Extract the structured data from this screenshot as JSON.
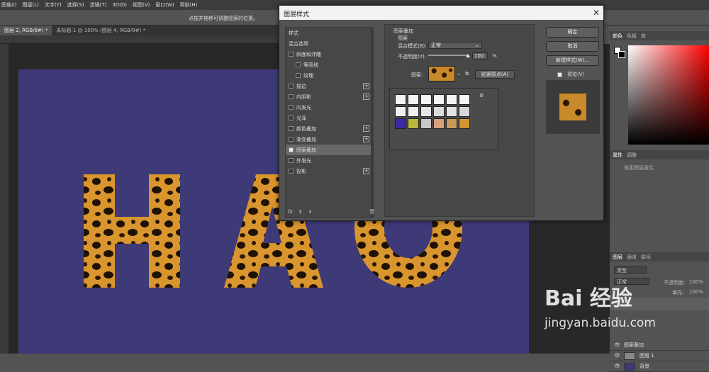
{
  "menubar": [
    "图像(I)",
    "图层(L)",
    "文字(Y)",
    "选择(S)",
    "滤镜(T)",
    "3D(D)",
    "视图(V)",
    "窗口(W)",
    "帮助(H)"
  ],
  "options_hint": "点按并拖移可调整图案的位置。",
  "tabs": [
    "图层 2, RGB/8#) *",
    "未标题-1 @ 100% (图层 4, RGB/8#) *"
  ],
  "dialog": {
    "title": "图层样式",
    "list_header": "样式",
    "items": [
      {
        "label": "混合选项",
        "check": false,
        "plus": false,
        "box": false,
        "selected": false
      },
      {
        "label": "斜面和浮雕",
        "check": false,
        "plus": false,
        "box": true,
        "selected": false
      },
      {
        "label": "等高线",
        "check": false,
        "plus": false,
        "box": true,
        "selected": false,
        "indent": true
      },
      {
        "label": "纹理",
        "check": false,
        "plus": false,
        "box": true,
        "selected": false,
        "indent": true
      },
      {
        "label": "描边",
        "check": false,
        "plus": true,
        "box": true,
        "selected": false
      },
      {
        "label": "内阴影",
        "check": false,
        "plus": true,
        "box": true,
        "selected": false
      },
      {
        "label": "内发光",
        "check": false,
        "plus": false,
        "box": true,
        "selected": false
      },
      {
        "label": "光泽",
        "check": false,
        "plus": false,
        "box": true,
        "selected": false
      },
      {
        "label": "颜色叠加",
        "check": false,
        "plus": true,
        "box": true,
        "selected": false
      },
      {
        "label": "渐变叠加",
        "check": false,
        "plus": true,
        "box": true,
        "selected": false
      },
      {
        "label": "图案叠加",
        "check": true,
        "plus": false,
        "box": true,
        "selected": true
      },
      {
        "label": "外发光",
        "check": false,
        "plus": false,
        "box": true,
        "selected": false
      },
      {
        "label": "投影",
        "check": false,
        "plus": true,
        "box": true,
        "selected": false
      }
    ],
    "footer_fx": "fx",
    "section_title": "图案叠加",
    "group_title": "图案",
    "blend_label": "混合模式(B):",
    "blend_value": "正常",
    "opacity_label": "不透明度(Y):",
    "opacity_value": "100",
    "opacity_unit": "%",
    "opacity_level": 1.0,
    "pattern_label": "图案:",
    "snap_button": "贴紧原点(A)",
    "buttons": {
      "ok": "确定",
      "cancel": "取消",
      "new_style": "新建样式(W)..."
    },
    "preview_label": "预览(V)",
    "swatch_colors": [
      "#f4f4f4",
      "#f4f4f4",
      "#f4f4f4",
      "#f4f4f4",
      "#f4f4f4",
      "#f4f4f4",
      "#f0f0f0",
      "#f0f0f0",
      "#e6e6e6",
      "#dcdcdc",
      "#e2e2e2",
      "#d8d8d8",
      "#3a2aa8",
      "#b8b83a",
      "#c8c8c8",
      "#d7a07a",
      "#c89a5a",
      "#d39430"
    ]
  },
  "right": {
    "color_tabs": [
      "颜色",
      "色板",
      "库"
    ],
    "props_tabs": [
      "属性",
      "调整"
    ],
    "props_hint": "像素图层属性",
    "layers_tabs": [
      "图层",
      "通道",
      "路径"
    ],
    "layer_filter": "类型",
    "blend": "正常",
    "opacity_label": "不透明度:",
    "opacity_value": "100%",
    "fill_label": "填充:",
    "fill_value": "100%",
    "effect_label": "图案叠加",
    "layers": [
      "图层 1",
      "背景"
    ]
  },
  "watermark": {
    "text": "Bai 经验",
    "sub": "jingyan.baidu.com"
  }
}
